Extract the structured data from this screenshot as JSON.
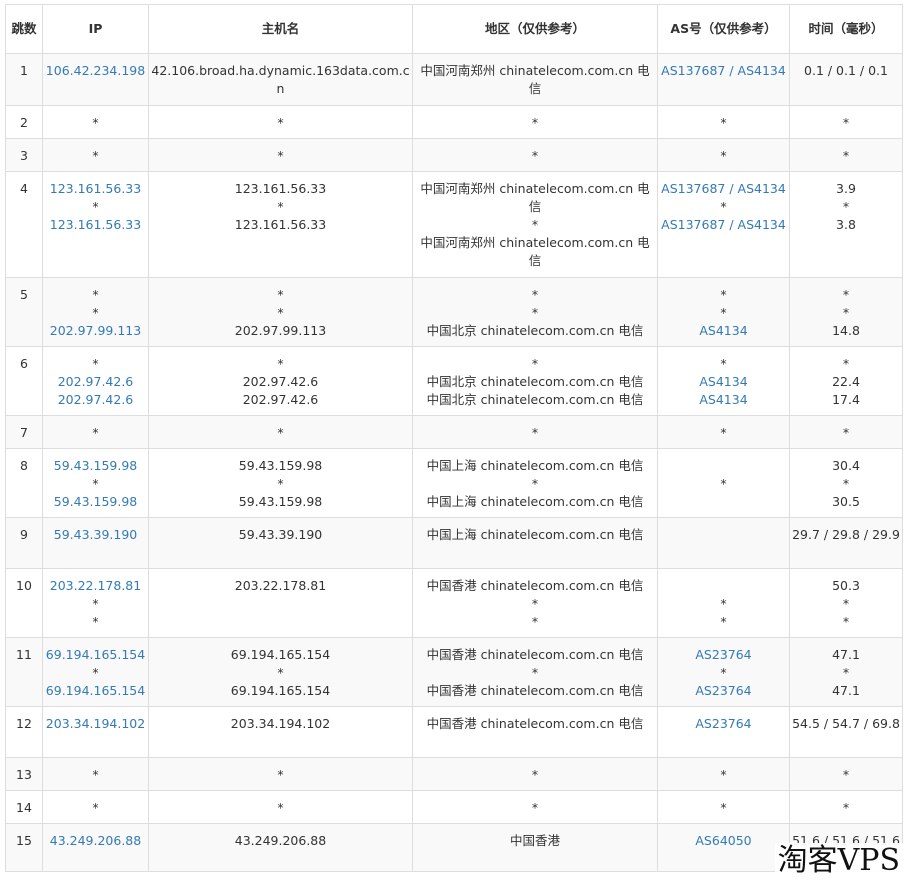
{
  "headers": [
    "跳数",
    "IP",
    "主机名",
    "地区（仅供参考）",
    "AS号（仅供参考）",
    "时间（毫秒）"
  ],
  "rows": [
    {
      "hop": "1",
      "ip": [
        "106.42.234.198"
      ],
      "host": [
        "42.106.broad.ha.dynamic.163data.com.cn"
      ],
      "region": [
        "中国河南郑州 chinatelecom.com.cn 电信"
      ],
      "asn": [
        "AS137687 / AS4134"
      ],
      "time": [
        "0.1 / 0.1 / 0.1"
      ]
    },
    {
      "hop": "2",
      "ip": [
        "*"
      ],
      "host": [
        "*"
      ],
      "region": [
        "*"
      ],
      "asn": [
        "*"
      ],
      "time": [
        "*"
      ]
    },
    {
      "hop": "3",
      "ip": [
        "*"
      ],
      "host": [
        "*"
      ],
      "region": [
        "*"
      ],
      "asn": [
        "*"
      ],
      "time": [
        "*"
      ]
    },
    {
      "hop": "4",
      "ip": [
        "123.161.56.33",
        "*",
        "123.161.56.33"
      ],
      "host": [
        "123.161.56.33",
        "*",
        "123.161.56.33"
      ],
      "region": [
        "中国河南郑州 chinatelecom.com.cn 电信",
        "*",
        "中国河南郑州 chinatelecom.com.cn 电信"
      ],
      "asn": [
        "AS137687 / AS4134",
        "*",
        "AS137687 / AS4134"
      ],
      "time": [
        "3.9",
        "*",
        "3.8"
      ]
    },
    {
      "hop": "5",
      "ip": [
        "*",
        "*",
        "202.97.99.113"
      ],
      "host": [
        "*",
        "*",
        "202.97.99.113"
      ],
      "region": [
        "*",
        "*",
        "中国北京 chinatelecom.com.cn 电信"
      ],
      "asn": [
        "*",
        "*",
        "AS4134"
      ],
      "time": [
        "*",
        "*",
        "14.8"
      ]
    },
    {
      "hop": "6",
      "ip": [
        "*",
        "202.97.42.6",
        "202.97.42.6"
      ],
      "host": [
        "*",
        "202.97.42.6",
        "202.97.42.6"
      ],
      "region": [
        "*",
        "中国北京 chinatelecom.com.cn 电信",
        "中国北京 chinatelecom.com.cn 电信"
      ],
      "asn": [
        "*",
        "AS4134",
        "AS4134"
      ],
      "time": [
        "*",
        "22.4",
        "17.4"
      ]
    },
    {
      "hop": "7",
      "ip": [
        "*"
      ],
      "host": [
        "*"
      ],
      "region": [
        "*"
      ],
      "asn": [
        "*"
      ],
      "time": [
        "*"
      ]
    },
    {
      "hop": "8",
      "ip": [
        "59.43.159.98",
        "*",
        "59.43.159.98"
      ],
      "host": [
        "59.43.159.98",
        "*",
        "59.43.159.98"
      ],
      "region": [
        "中国上海 chinatelecom.com.cn 电信",
        "*",
        "中国上海 chinatelecom.com.cn 电信"
      ],
      "asn": [
        "",
        "*",
        ""
      ],
      "time": [
        "30.4",
        "*",
        "30.5"
      ]
    },
    {
      "hop": "9",
      "ip": [
        "59.43.39.190"
      ],
      "host": [
        "59.43.39.190"
      ],
      "region": [
        "中国上海 chinatelecom.com.cn 电信"
      ],
      "asn": [
        ""
      ],
      "time": [
        "29.7 / 29.8 / 29.9"
      ]
    },
    {
      "hop": "10",
      "ip": [
        "203.22.178.81",
        "*",
        "*"
      ],
      "host": [
        "203.22.178.81",
        "",
        ""
      ],
      "region": [
        "中国香港 chinatelecom.com.cn 电信",
        "*",
        "*"
      ],
      "asn": [
        "",
        "*",
        "*"
      ],
      "time": [
        "50.3",
        "*",
        "*"
      ]
    },
    {
      "hop": "11",
      "ip": [
        "69.194.165.154",
        "*",
        "69.194.165.154"
      ],
      "host": [
        "69.194.165.154",
        "*",
        "69.194.165.154"
      ],
      "region": [
        "中国香港 chinatelecom.com.cn 电信",
        "*",
        "中国香港 chinatelecom.com.cn 电信"
      ],
      "asn": [
        "AS23764",
        "*",
        "AS23764"
      ],
      "time": [
        "47.1",
        "*",
        "47.1"
      ]
    },
    {
      "hop": "12",
      "ip": [
        "203.34.194.102"
      ],
      "host": [
        "203.34.194.102"
      ],
      "region": [
        "中国香港 chinatelecom.com.cn 电信"
      ],
      "asn": [
        "AS23764"
      ],
      "time": [
        "54.5 / 54.7 / 69.8"
      ]
    },
    {
      "hop": "13",
      "ip": [
        "*"
      ],
      "host": [
        "*"
      ],
      "region": [
        "*"
      ],
      "asn": [
        "*"
      ],
      "time": [
        "*"
      ]
    },
    {
      "hop": "14",
      "ip": [
        "*"
      ],
      "host": [
        "*"
      ],
      "region": [
        "*"
      ],
      "asn": [
        "*"
      ],
      "time": [
        "*"
      ]
    },
    {
      "hop": "15",
      "ip": [
        "43.249.206.88"
      ],
      "host": [
        "43.249.206.88"
      ],
      "region": [
        "中国香港"
      ],
      "asn": [
        "AS64050"
      ],
      "time": [
        "51.6 / 51.6 / 51.6"
      ]
    }
  ],
  "watermark": "淘客VPS",
  "colors": {
    "link": "#337ab7",
    "border": "#dddddd",
    "stripe": "#f9f9f9"
  }
}
